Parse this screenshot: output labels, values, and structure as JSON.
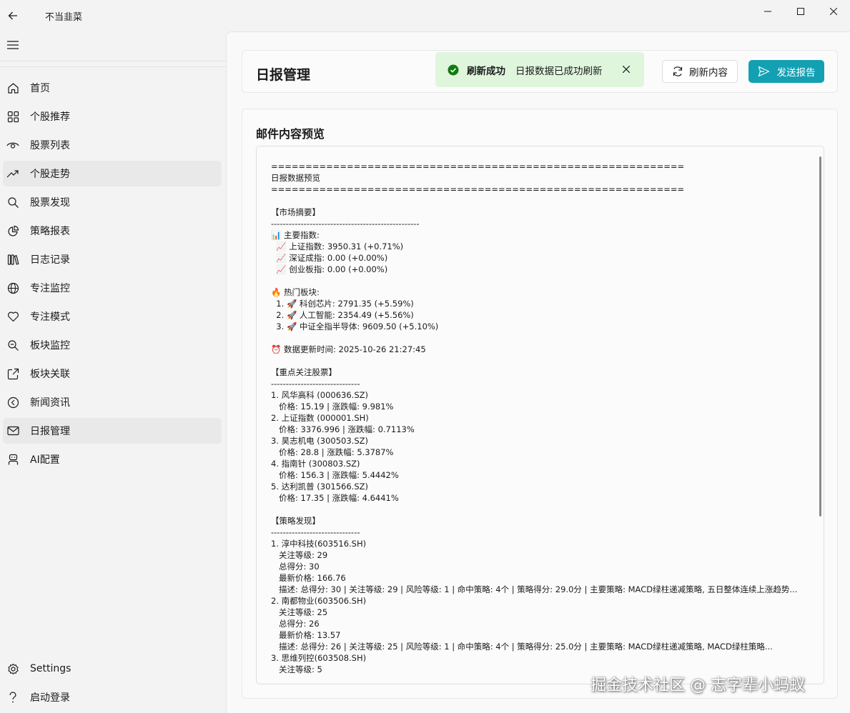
{
  "window": {
    "title": "不当韭菜"
  },
  "sidebar": {
    "items": [
      {
        "label": "首页",
        "icon": "home-icon"
      },
      {
        "label": "个股推荐",
        "icon": "grid-icon"
      },
      {
        "label": "股票列表",
        "icon": "eye-icon"
      },
      {
        "label": "个股走势",
        "icon": "trend-icon"
      },
      {
        "label": "股票发现",
        "icon": "search-icon"
      },
      {
        "label": "策略报表",
        "icon": "pie-icon"
      },
      {
        "label": "日志记录",
        "icon": "library-icon"
      },
      {
        "label": "专注监控",
        "icon": "globe-icon"
      },
      {
        "label": "专注模式",
        "icon": "heart-icon"
      },
      {
        "label": "板块监控",
        "icon": "zoom-icon"
      },
      {
        "label": "板块关联",
        "icon": "share-icon"
      },
      {
        "label": "新闻资讯",
        "icon": "back-circle-icon"
      },
      {
        "label": "日报管理",
        "icon": "mail-icon"
      },
      {
        "label": "AI配置",
        "icon": "bot-icon"
      }
    ],
    "bottom": [
      {
        "label": "Settings",
        "icon": "gear-icon"
      },
      {
        "label": "启动登录",
        "icon": "question-icon"
      }
    ]
  },
  "header": {
    "title": "日报管理",
    "refresh_label": "刷新内容",
    "send_label": "发送报告"
  },
  "toast": {
    "title": "刷新成功",
    "message": "日报数据已成功刷新"
  },
  "preview": {
    "title": "邮件内容预览",
    "body": "============================================================\n日报数据预览\n============================================================\n\n【市场摘要】\n--------------------------------------------------\n📊 主要指数:\n  📈 上证指数: 3950.31 (+0.71%)\n  📈 深证成指: 0.00 (+0.00%)\n  📈 创业板指: 0.00 (+0.00%)\n\n🔥 热门板块:\n  1. 🚀 科创芯片: 2791.35 (+5.59%)\n  2. 🚀 人工智能: 2354.49 (+5.56%)\n  3. 🚀 中证全指半导体: 9609.50 (+5.10%)\n\n⏰ 数据更新时间: 2025-10-26 21:27:45\n\n【重点关注股票】\n------------------------------\n1. 风华高科 (000636.SZ)\n   价格: 15.19 | 涨跌幅: 9.981%\n2. 上证指数 (000001.SH)\n   价格: 3376.996 | 涨跌幅: 0.7113%\n3. 昊志机电 (300503.SZ)\n   价格: 28.8 | 涨跌幅: 5.3787%\n4. 指南针 (300803.SZ)\n   价格: 156.3 | 涨跌幅: 5.4442%\n5. 达利凯普 (301566.SZ)\n   价格: 17.35 | 涨跌幅: 4.6441%\n\n【策略发现】\n------------------------------\n1. 淳中科技(603516.SH)\n   关注等级: 29\n   总得分: 30\n   最新价格: 166.76\n   描述: 总得分: 30 | 关注等级: 29 | 风险等级: 1 | 命中策略: 4个 | 策略得分: 29.0分 | 主要策略: MACD绿柱递减策略, 五日整体连续上涨趋势...\n2. 南都物业(603506.SH)\n   关注等级: 25\n   总得分: 26\n   最新价格: 13.57\n   描述: 总得分: 26 | 关注等级: 25 | 风险等级: 1 | 命中策略: 4个 | 策略得分: 25.0分 | 主要策略: MACD绿柱递减策略, MACD绿柱策略...\n3. 思维列控(603508.SH)\n   关注等级: 5"
  },
  "watermark": "掘金技术社区 @ 志字辈小蚂蚁",
  "colors": {
    "accent": "#14a0b3",
    "toast_bg": "#dff6dd",
    "toast_icon": "#107c10"
  }
}
